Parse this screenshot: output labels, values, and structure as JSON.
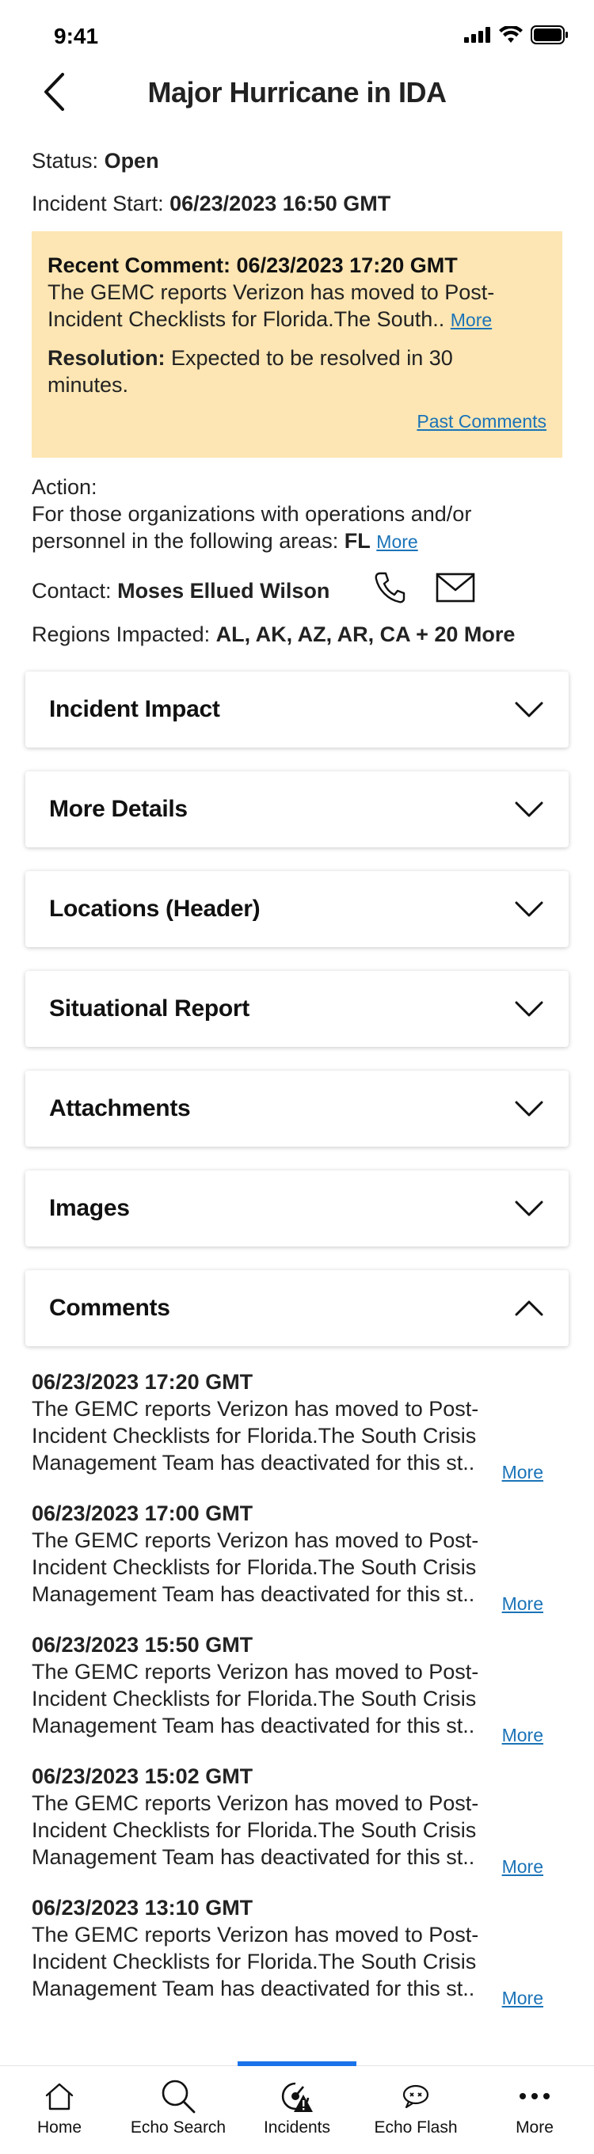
{
  "status_bar": {
    "time": "9:41"
  },
  "header": {
    "title": "Major Hurricane in IDA"
  },
  "status": {
    "label": "Status:",
    "value": "Open"
  },
  "incident_start": {
    "label": "Incident Start:",
    "value": "06/23/2023 16:50 GMT"
  },
  "recent_comment": {
    "heading": "Recent Comment: 06/23/2023 17:20 GMT",
    "line1": "The GEMC reports Verizon has moved to Post-",
    "line2": "Incident Checklists for Florida.The South..",
    "more": "More",
    "resolution_label": "Resolution:",
    "resolution_line1": "Expected to be resolved in 30",
    "resolution_line2": "minutes.",
    "past_comments": "Past Comments"
  },
  "action": {
    "label": "Action:",
    "line1": "For those organizations with operations and/or",
    "line2_prefix": "personnel in the following areas:",
    "area": "FL",
    "more": "More"
  },
  "contact": {
    "label": "Contact:",
    "name": "Moses Ellued Wilson"
  },
  "regions": {
    "label": "Regions Impacted:",
    "value": "AL, AK, AZ, AR, CA + 20 More"
  },
  "sections": [
    {
      "title": "Incident Impact"
    },
    {
      "title": "More Details"
    },
    {
      "title": "Locations (Header)"
    },
    {
      "title": "Situational Report"
    },
    {
      "title": "Attachments"
    },
    {
      "title": "Images"
    },
    {
      "title": "Comments"
    }
  ],
  "comments": [
    {
      "date": "06/23/2023 17:20 GMT",
      "l1": "The GEMC reports Verizon has moved to Post-",
      "l2": "Incident Checklists for Florida.The South Crisis",
      "l3": "Management Team has deactivated for this st..",
      "more": "More"
    },
    {
      "date": "06/23/2023 17:00 GMT",
      "l1": "The GEMC reports Verizon has moved to Post-",
      "l2": "Incident Checklists for Florida.The South Crisis",
      "l3": "Management Team has deactivated for this st..",
      "more": "More"
    },
    {
      "date": "06/23/2023 15:50 GMT",
      "l1": "The GEMC reports Verizon has moved to Post-",
      "l2": "Incident Checklists for Florida.The South Crisis",
      "l3": "Management Team has deactivated for this st..",
      "more": "More"
    },
    {
      "date": "06/23/2023 15:02 GMT",
      "l1": "The GEMC reports Verizon has moved to Post-",
      "l2": "Incident Checklists for Florida.The South Crisis",
      "l3": "Management Team has deactivated for this st..",
      "more": "More"
    },
    {
      "date": "06/23/2023 13:10 GMT",
      "l1": "The GEMC reports Verizon has moved to Post-",
      "l2": "Incident Checklists for Florida.The South Crisis",
      "l3": "Management Team has deactivated for this st..",
      "more": "More"
    }
  ],
  "tabbar": [
    {
      "label": "Home",
      "icon": "home-icon"
    },
    {
      "label": "Echo Search",
      "icon": "search-icon"
    },
    {
      "label": "Incidents",
      "icon": "incidents-alert-icon",
      "active": true
    },
    {
      "label": "Echo Flash",
      "icon": "echo-flash-icon"
    },
    {
      "label": "More",
      "icon": "more-dots-icon"
    }
  ],
  "colors": {
    "comment_box_bg": "#fde6b3",
    "link": "#1a73b8",
    "active_tab": "#1a73e8"
  }
}
